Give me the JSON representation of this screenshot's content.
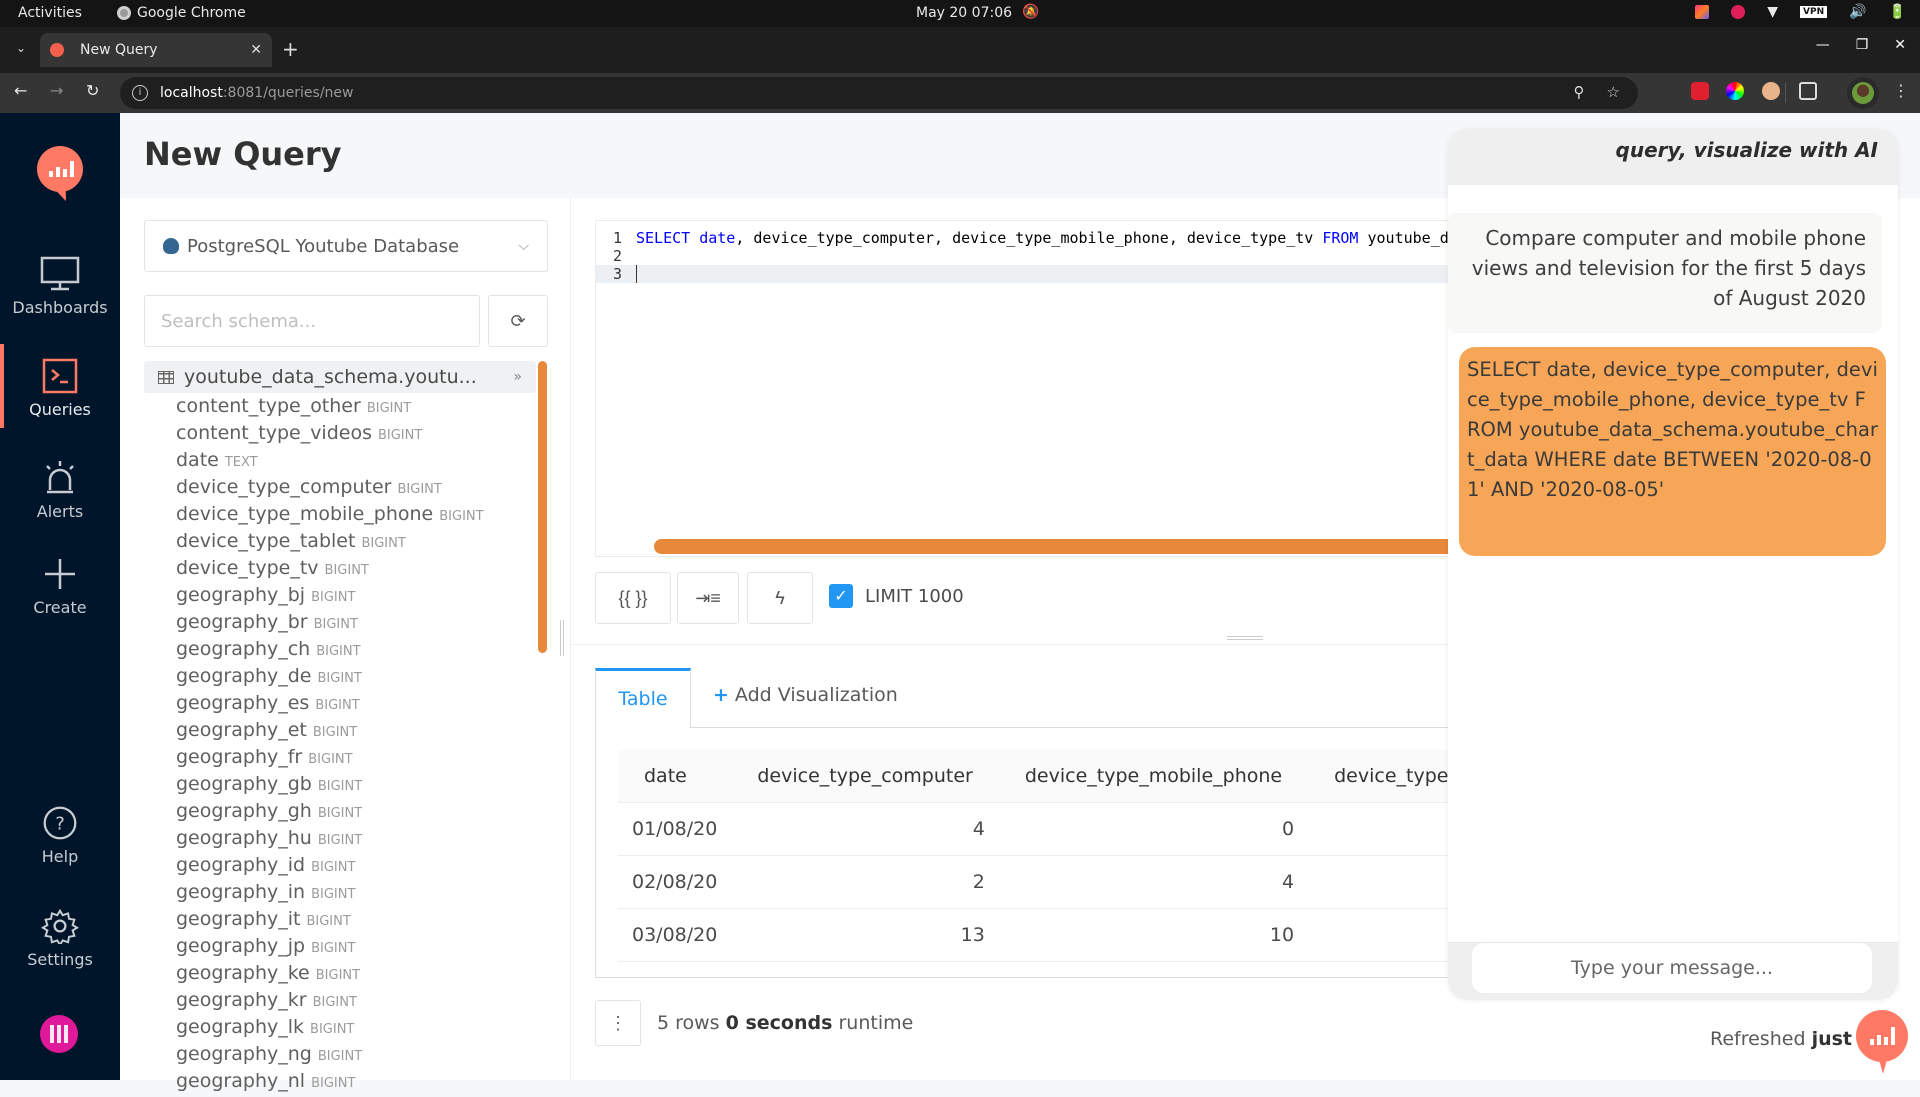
{
  "os": {
    "activities": "Activities",
    "app_name": "Google Chrome",
    "clock": "May 20  07:06",
    "vpn_label": "VPN"
  },
  "browser": {
    "tab_title": "New Query",
    "url_host": "localhost",
    "url_path": ":8081/queries/new"
  },
  "sidebar": {
    "items": [
      {
        "label": "Dashboards",
        "icon": "monitor-icon"
      },
      {
        "label": "Queries",
        "icon": "terminal-icon",
        "active": true
      },
      {
        "label": "Alerts",
        "icon": "siren-icon"
      },
      {
        "label": "Create",
        "icon": "plus-icon"
      },
      {
        "label": "Help",
        "icon": "question-circle-icon"
      },
      {
        "label": "Settings",
        "icon": "gear-icon"
      }
    ],
    "accent": "#ff7964",
    "background": "#001529"
  },
  "page": {
    "title": "New Query"
  },
  "schema": {
    "datasource": "PostgreSQL Youtube Database",
    "search_placeholder": "Search schema...",
    "table_name": "youtube_data_schema.youtu...",
    "columns": [
      {
        "name": "content_type_other",
        "type": "BIGINT"
      },
      {
        "name": "content_type_videos",
        "type": "BIGINT"
      },
      {
        "name": "date",
        "type": "TEXT"
      },
      {
        "name": "device_type_computer",
        "type": "BIGINT"
      },
      {
        "name": "device_type_mobile_phone",
        "type": "BIGINT"
      },
      {
        "name": "device_type_tablet",
        "type": "BIGINT"
      },
      {
        "name": "device_type_tv",
        "type": "BIGINT"
      },
      {
        "name": "geography_bj",
        "type": "BIGINT"
      },
      {
        "name": "geography_br",
        "type": "BIGINT"
      },
      {
        "name": "geography_ch",
        "type": "BIGINT"
      },
      {
        "name": "geography_de",
        "type": "BIGINT"
      },
      {
        "name": "geography_es",
        "type": "BIGINT"
      },
      {
        "name": "geography_et",
        "type": "BIGINT"
      },
      {
        "name": "geography_fr",
        "type": "BIGINT"
      },
      {
        "name": "geography_gb",
        "type": "BIGINT"
      },
      {
        "name": "geography_gh",
        "type": "BIGINT"
      },
      {
        "name": "geography_hu",
        "type": "BIGINT"
      },
      {
        "name": "geography_id",
        "type": "BIGINT"
      },
      {
        "name": "geography_in",
        "type": "BIGINT"
      },
      {
        "name": "geography_it",
        "type": "BIGINT"
      },
      {
        "name": "geography_jp",
        "type": "BIGINT"
      },
      {
        "name": "geography_ke",
        "type": "BIGINT"
      },
      {
        "name": "geography_kr",
        "type": "BIGINT"
      },
      {
        "name": "geography_lk",
        "type": "BIGINT"
      },
      {
        "name": "geography_ng",
        "type": "BIGINT"
      },
      {
        "name": "geography_nl",
        "type": "BIGINT"
      }
    ]
  },
  "editor": {
    "lines": [
      {
        "num": "1",
        "kw1": "SELECT",
        "t1": " ",
        "kw2": "date",
        "t2": ", device_type_computer, device_type_mobile_phone, device_type_tv ",
        "kw3": "FROM",
        "t3": " youtube_data_schema.youtube_chart_data"
      },
      {
        "num": "2"
      },
      {
        "num": "3"
      }
    ],
    "param_button": "{{ }}",
    "limit_label": "LIMIT 1000",
    "limit_checked": true
  },
  "results": {
    "tabs": {
      "table": "Table",
      "add_visualization": "Add Visualization"
    },
    "columns": [
      "date",
      "device_type_computer",
      "device_type_mobile_phone",
      "device_type_tv"
    ],
    "rows": [
      [
        "01/08/20",
        "4",
        "0",
        ""
      ],
      [
        "02/08/20",
        "2",
        "4",
        ""
      ],
      [
        "03/08/20",
        "13",
        "10",
        ""
      ]
    ],
    "row_count": "5 rows",
    "runtime": "0 seconds",
    "runtime_suffix": "runtime",
    "refreshed_prefix": "Refreshed",
    "refreshed_value": "just n"
  },
  "chat": {
    "title": "query, visualize with AI",
    "user_message": "Compare computer and mobile phone views and television for the first 5 days of August 2020",
    "ai_message": "SELECT date, device_type_computer, device_type_mobile_phone, device_type_tv FROM youtube_data_schema.youtube_chart_data WHERE date BETWEEN '2020-08-01' AND '2020-08-05'",
    "input_placeholder": "Type your message...",
    "ai_bubble_color": "#f7a556"
  }
}
